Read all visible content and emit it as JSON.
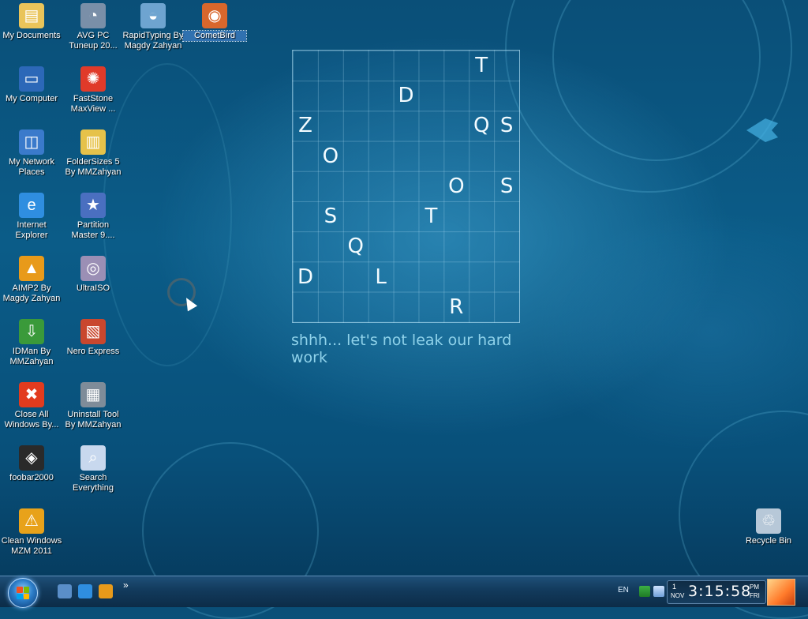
{
  "desktop_icons": [
    {
      "label": "My Documents",
      "icon": "folder-documents-icon",
      "color": "#e9c45a",
      "glyph": "▤"
    },
    {
      "label": "AVG PC\nTuneup 20...",
      "icon": "avg-tuneup-icon",
      "color": "#7a8fa8",
      "glyph": "◔"
    },
    {
      "label": "RapidTyping By\nMagdy Zahyan",
      "icon": "rapidtyping-icon",
      "color": "#6ea4d0",
      "glyph": "◒"
    },
    {
      "label": "CometBird",
      "icon": "cometbird-icon",
      "color": "#d8672c",
      "glyph": "◉"
    },
    {
      "label": "My Computer",
      "icon": "computer-icon",
      "color": "#2c68b8",
      "glyph": "▭"
    },
    {
      "label": "FastStone\nMaxView ...",
      "icon": "faststone-icon",
      "color": "#e03a2a",
      "glyph": "✺"
    },
    {
      "label": "My Network\nPlaces",
      "icon": "network-places-icon",
      "color": "#3a7acb",
      "glyph": "◫"
    },
    {
      "label": "FolderSizes 5\nBy MMZahyan",
      "icon": "foldersizes-icon",
      "color": "#e6c24a",
      "glyph": "▥"
    },
    {
      "label": "Internet\nExplorer",
      "icon": "internet-explorer-icon",
      "color": "#2f8ee0",
      "glyph": "e"
    },
    {
      "label": "Partition\nMaster 9....",
      "icon": "partition-master-icon",
      "color": "#4a6fc0",
      "glyph": "★"
    },
    {
      "label": "AIMP2 By\nMagdy Zahyan",
      "icon": "aimp-icon",
      "color": "#e89a1a",
      "glyph": "▲"
    },
    {
      "label": "UltraISO",
      "icon": "ultraiso-icon",
      "color": "#9b8fb5",
      "glyph": "◎"
    },
    {
      "label": "IDMan By\nMMZahyan",
      "icon": "idm-icon",
      "color": "#3a9a3a",
      "glyph": "⇩"
    },
    {
      "label": "Nero Express",
      "icon": "nero-express-icon",
      "color": "#c9472e",
      "glyph": "▧"
    },
    {
      "label": "Close All\nWindows By...",
      "icon": "close-all-icon",
      "color": "#e23b1e",
      "glyph": "✖"
    },
    {
      "label": "Uninstall Tool\nBy MMZahyan",
      "icon": "uninstall-tool-icon",
      "color": "#7f8c99",
      "glyph": "▦"
    },
    {
      "label": "foobar2000",
      "icon": "foobar2000-icon",
      "color": "#2a2a2a",
      "glyph": "◈"
    },
    {
      "label": "Search\nEverything",
      "icon": "search-everything-icon",
      "color": "#c8d8ee",
      "glyph": "⌕"
    },
    {
      "label": "Clean Windows\nMZM 2011",
      "icon": "clean-windows-icon",
      "color": "#e8a21a",
      "glyph": "⚠"
    },
    {
      "label": "Recycle Bin",
      "icon": "recycle-bin-icon",
      "color": "#b7c8d8",
      "glyph": "♲"
    }
  ],
  "wallpaper": {
    "grid_letters": [
      {
        "ch": "T",
        "row": 0,
        "col": 7
      },
      {
        "ch": "D",
        "row": 1,
        "col": 4
      },
      {
        "ch": "Z",
        "row": 2,
        "col": 0
      },
      {
        "ch": "Q",
        "row": 2,
        "col": 7
      },
      {
        "ch": "S",
        "row": 2,
        "col": 8
      },
      {
        "ch": "O",
        "row": 3,
        "col": 1
      },
      {
        "ch": "O",
        "row": 4,
        "col": 6
      },
      {
        "ch": "S",
        "row": 4,
        "col": 8
      },
      {
        "ch": "S",
        "row": 5,
        "col": 1
      },
      {
        "ch": "T",
        "row": 5,
        "col": 5
      },
      {
        "ch": "Q",
        "row": 6,
        "col": 2
      },
      {
        "ch": "D",
        "row": 7,
        "col": 0
      },
      {
        "ch": "L",
        "row": 7,
        "col": 3
      },
      {
        "ch": "R",
        "row": 8,
        "col": 6
      }
    ],
    "caption": "shhh... let's not leak our hard work"
  },
  "taskbar": {
    "start_icon": "windows-start-icon",
    "quick_launch": [
      {
        "icon": "show-desktop-ql-icon",
        "color": "#5a8ec8"
      },
      {
        "icon": "internet-explorer-ql-icon",
        "color": "#2f8ee0"
      },
      {
        "icon": "aimp-ql-icon",
        "color": "#e89a1a"
      }
    ],
    "overflow": "»",
    "tray": {
      "language": "EN",
      "clock_day": "1",
      "clock_month": "NOV",
      "clock_time": "3:15:58",
      "clock_ampm": "PM",
      "clock_weekday": "FRI"
    }
  },
  "colors": {
    "accent": "#1e4f78",
    "caption": "#8fd2ea"
  }
}
